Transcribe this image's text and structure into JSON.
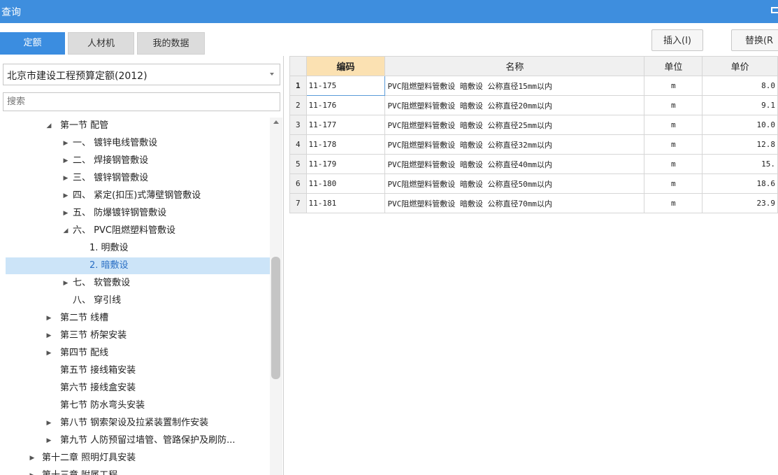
{
  "window": {
    "title": "查询"
  },
  "tabs": [
    {
      "label": "定额",
      "active": true
    },
    {
      "label": "人材机",
      "active": false
    },
    {
      "label": "我的数据",
      "active": false
    }
  ],
  "actions": {
    "insert": "插入(I)",
    "replace": "替换(R"
  },
  "library": {
    "selected": "北京市建设工程预算定额(2012)"
  },
  "search": {
    "placeholder": "搜索"
  },
  "tree": [
    {
      "label": "第一节 配管",
      "state": "expanded"
    },
    {
      "label": "一、 镀锌电线管敷设",
      "state": "collapsed"
    },
    {
      "label": "二、 焊接钢管敷设",
      "state": "collapsed"
    },
    {
      "label": "三、 镀锌钢管敷设",
      "state": "collapsed"
    },
    {
      "label": "四、 紧定(扣压)式薄壁钢管敷设",
      "state": "collapsed"
    },
    {
      "label": "五、 防爆镀锌钢管敷设",
      "state": "collapsed"
    },
    {
      "label": "六、 PVC阻燃塑料管敷设",
      "state": "expanded"
    },
    {
      "label": "1. 明敷设",
      "state": "leaf"
    },
    {
      "label": "2. 暗敷设",
      "state": "leaf",
      "selected": true
    },
    {
      "label": "七、 软管敷设",
      "state": "collapsed"
    },
    {
      "label": "八、 穿引线",
      "state": "leaf"
    },
    {
      "label": "第二节 线槽",
      "state": "collapsed"
    },
    {
      "label": "第三节 桥架安装",
      "state": "collapsed"
    },
    {
      "label": "第四节 配线",
      "state": "collapsed"
    },
    {
      "label": "第五节 接线箱安装",
      "state": "leaf"
    },
    {
      "label": "第六节 接线盒安装",
      "state": "leaf"
    },
    {
      "label": "第七节 防水弯头安装",
      "state": "leaf"
    },
    {
      "label": "第八节 钢索架设及拉紧装置制作安装",
      "state": "collapsed"
    },
    {
      "label": "第九节 人防预留过墙管、管路保护及刷防...",
      "state": "collapsed"
    },
    {
      "label": "第十二章 照明灯具安装",
      "state": "collapsed"
    },
    {
      "label": "第十三章 附属工程",
      "state": "collapsed"
    }
  ],
  "grid": {
    "columns": [
      "编码",
      "名称",
      "单位",
      "单价"
    ],
    "rows": [
      {
        "no": "1",
        "code": "11-175",
        "name": "PVC阻燃塑料管敷设 暗敷设 公称直径15mm以内",
        "unit": "m",
        "price": "8.0"
      },
      {
        "no": "2",
        "code": "11-176",
        "name": "PVC阻燃塑料管敷设 暗敷设 公称直径20mm以内",
        "unit": "m",
        "price": "9.1"
      },
      {
        "no": "3",
        "code": "11-177",
        "name": "PVC阻燃塑料管敷设 暗敷设 公称直径25mm以内",
        "unit": "m",
        "price": "10.0"
      },
      {
        "no": "4",
        "code": "11-178",
        "name": "PVC阻燃塑料管敷设 暗敷设 公称直径32mm以内",
        "unit": "m",
        "price": "12.8"
      },
      {
        "no": "5",
        "code": "11-179",
        "name": "PVC阻燃塑料管敷设 暗敷设 公称直径40mm以内",
        "unit": "m",
        "price": "15."
      },
      {
        "no": "6",
        "code": "11-180",
        "name": "PVC阻燃塑料管敷设 暗敷设 公称直径50mm以内",
        "unit": "m",
        "price": "18.6"
      },
      {
        "no": "7",
        "code": "11-181",
        "name": "PVC阻燃塑料管敷设 暗敷设 公称直径70mm以内",
        "unit": "m",
        "price": "23.9"
      }
    ]
  },
  "colors": {
    "titlebar": "#3e8ede",
    "active_tab": "#3b8de0",
    "selection": "#cce4f8",
    "header_highlight": "#fbe1b2"
  }
}
